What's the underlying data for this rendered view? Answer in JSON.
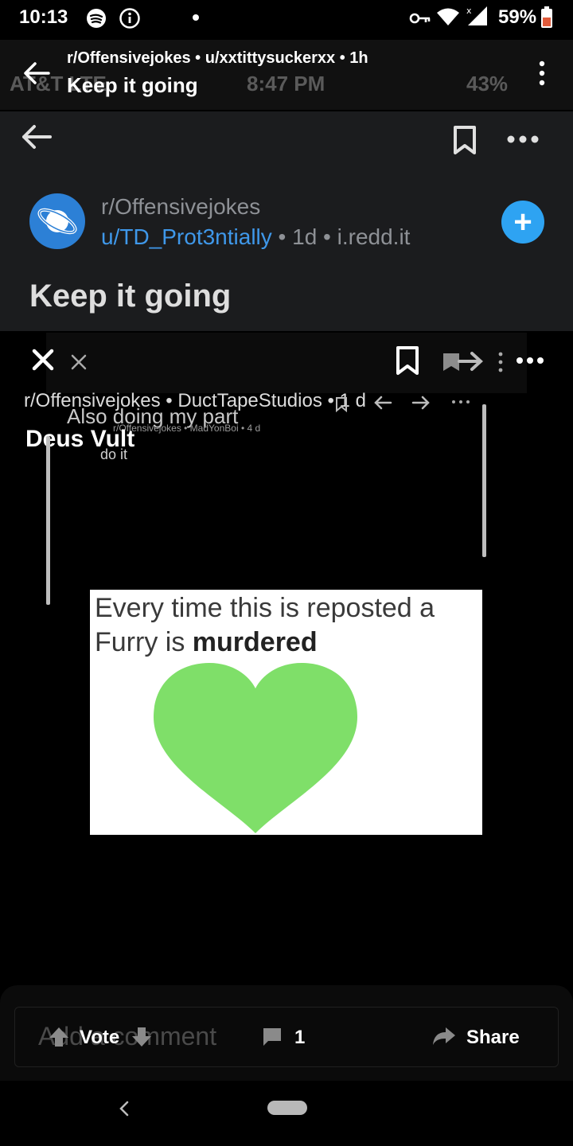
{
  "status_bar": {
    "time": "10:13",
    "battery": "59%",
    "icons": [
      "spotify-icon",
      "info-icon",
      "dot-icon",
      "vpn-key-icon",
      "wifi-icon",
      "signal-icon",
      "battery-icon"
    ]
  },
  "outer_toolbar": {
    "subtitle": "r/Offensivejokes • u/xxtittysuckerxx • 1h",
    "title": "Keep it going",
    "ghost_carrier": "AT&T LTE",
    "ghost_time": "8:47 PM",
    "ghost_battery": "43%"
  },
  "inner_post": {
    "subreddit": "r/Offensivejokes",
    "username": "u/TD_Prot3ntially",
    "age": " • 1d • ",
    "domain": "i.redd.it",
    "title": "Keep it going"
  },
  "nested_post": {
    "meta": "r/Offensivejokes • DuctTapeStudios • 1 d",
    "also_doing": "Also doing my part",
    "tiny_meta": "r/Offensivejokes • MadYonBoi • 4 d",
    "deus_vult": "Deus Vult",
    "do_it": "do it"
  },
  "meme": {
    "line1": "Every time this is reposted a",
    "line2_prefix": "Furry is ",
    "line2_bold": "murdered",
    "heart_color": "#7fdf69"
  },
  "bottom_bar": {
    "ghost_placeholder": "Add a comment",
    "vote_label": "Vote",
    "comment_count": "1",
    "share_label": "Share"
  },
  "colors": {
    "accent_blue": "#2ea3f2",
    "username_blue": "#3f98ea",
    "header_bg": "#1b1c1e"
  }
}
